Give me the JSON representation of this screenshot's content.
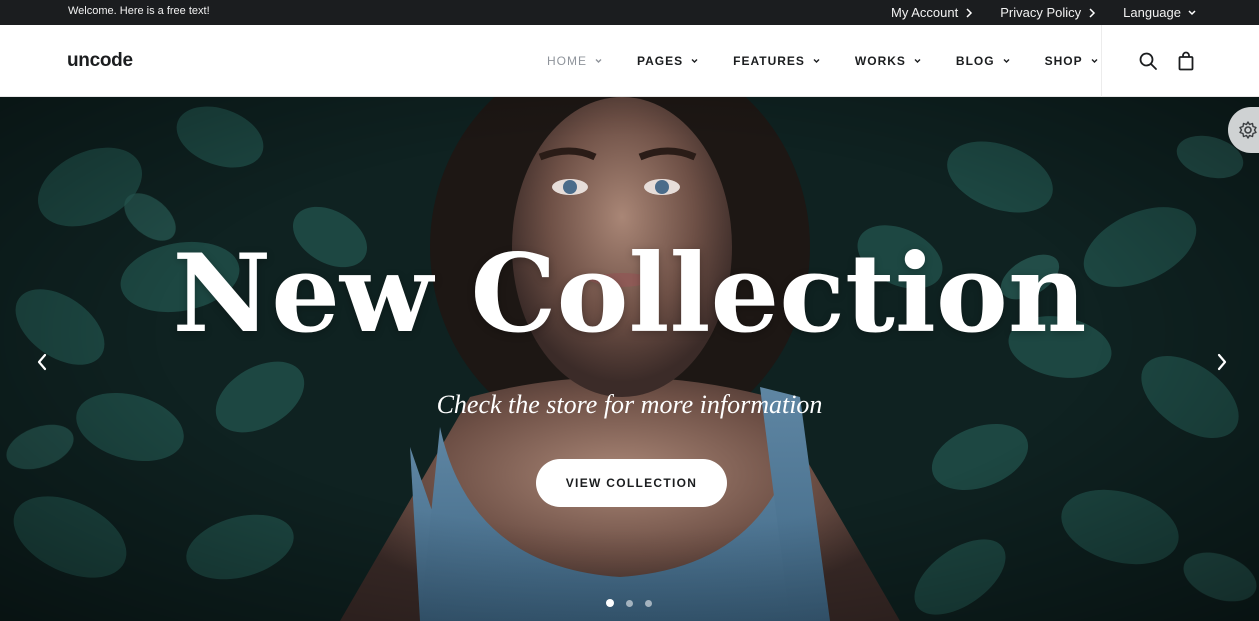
{
  "topbar": {
    "welcome": "Welcome. Here is a free text!",
    "links": [
      {
        "label": "My Account"
      },
      {
        "label": "Privacy Policy"
      },
      {
        "label": "Language"
      }
    ]
  },
  "header": {
    "logo": "uncode",
    "nav": [
      {
        "label": "HOME",
        "active": true
      },
      {
        "label": "PAGES"
      },
      {
        "label": "FEATURES"
      },
      {
        "label": "WORKS"
      },
      {
        "label": "BLOG"
      },
      {
        "label": "SHOP"
      }
    ],
    "icons": [
      "search-icon",
      "shopping-bag-icon"
    ]
  },
  "hero": {
    "title": "New Collection",
    "subtitle": "Check the store for more information",
    "button_label": "VIEW COLLECTION",
    "slides_total": 3,
    "active_slide": 1
  },
  "colors": {
    "topbar_bg": "#1b1d1f",
    "text_dark": "#1b1d1f",
    "nav_active": "#8f949b",
    "hero_bg": "#0f2221"
  }
}
